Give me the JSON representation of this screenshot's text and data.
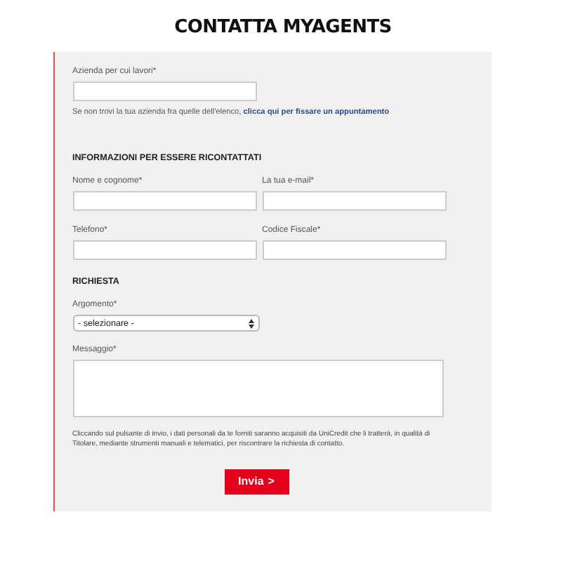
{
  "title": "CONTATTA MYAGENTS",
  "company": {
    "label": "Azienda per cui lavori*",
    "note": "Se non trovi la tua azienda fra quelle dell'elenco,",
    "link": "clicca qui per fissare un appuntamento"
  },
  "contact_section": {
    "heading": "INFORMAZIONI PER ESSERE RICONTATTATI",
    "fields": [
      {
        "label": "Nome e cognome*"
      },
      {
        "label": "La tua e-mail*"
      },
      {
        "label": "Telefono*"
      },
      {
        "label": "Codice Fiscale*"
      }
    ]
  },
  "request_section": {
    "heading": "RICHIESTA",
    "topic": {
      "label": "Argomento*",
      "value": "- selezionare -"
    },
    "message": {
      "label": "Messaggio*"
    }
  },
  "privacy": "Cliccando sul pulsante di invio, i dati personali da te forniti saranno acquisiti da UniCredit che li tratterà, in qualità di Titolare, mediante strumenti manuali e telematici, per riscontrare la richiesta di contatto.",
  "submit": {
    "label": "Invia",
    "arrow": ">"
  }
}
